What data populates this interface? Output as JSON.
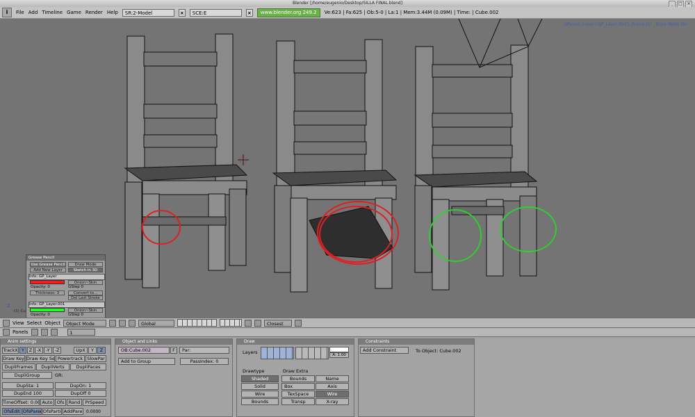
{
  "window": {
    "title": "Blender [/home/eugenio/Desktop/SILLA FINAL.blend]"
  },
  "menubar": {
    "info_icon": "i",
    "items": [
      "File",
      "Add",
      "Timeline",
      "Game",
      "Render",
      "Help"
    ],
    "screen": "SR:2-Model",
    "scene": "SCE:E",
    "url": "www.blender.org 249.2",
    "stats": "Ve:623 | Fa:625 | Ob:5-0 | La:1 | Mem:3.44M (0.09M) | Time: | Cube.002"
  },
  "viewport": {
    "overlay": "GPencil: Layer ('GP_Layer.001'), Frame (1) , Draw Mode On",
    "frame_label": "(1) Cu",
    "axis_label": "z"
  },
  "grease_pencil": {
    "title": "Grease Pencil",
    "use_btn": "Use Grease Pencil",
    "draw_mode": "Draw Mode",
    "add_layer": "Add New Layer",
    "sketch": "Sketch in 3D",
    "layer1": {
      "name": "Info: GP_Layer",
      "opacity": "Opacity: 0",
      "onion": "Onion~Skin",
      "gstep": "GStep 0",
      "thickness": "Thickness: 3",
      "convert": "Convert to...",
      "del": "Del Last Stroke",
      "color": "#ff1a1a"
    },
    "layer2": {
      "name": "Info: GP_Layer.001",
      "opacity": "Opacity: 0",
      "onion": "Onion~Skin",
      "gstep": "GStep 0",
      "color": "#22ff22"
    }
  },
  "view_header": {
    "items": [
      "View",
      "Select",
      "Object"
    ],
    "mode": "Object Mode",
    "orientation": "Global",
    "snap": "Closest"
  },
  "buttons_header": {
    "panels": "Panels",
    "frame": "1"
  },
  "anim_settings": {
    "title": "Anim settings",
    "track": [
      "TrackX",
      "Y",
      "Z",
      "-X",
      "-Y",
      "-Z"
    ],
    "up": [
      "UpX",
      "Y",
      "Z"
    ],
    "row2": [
      "Draw Key",
      "Draw Key Sel",
      "Powertrack",
      "SlowPar"
    ],
    "row3": [
      "DupliFrames",
      "DupliVerts",
      "DupliFaces"
    ],
    "dupligroup": "DupliGroup",
    "gr": "GR:",
    "dupsta": "DupSta: 1",
    "dupon": "DupOn: 1",
    "dupend": "DupEnd 100",
    "dupoff": "DupOff 0",
    "timeoffset": "TimeOffset: 0.00",
    "auto": "Auto",
    "ofs": "Ofs",
    "rand": "Rand",
    "prspeed": "PrSpeed",
    "ofsedit": "OfsEdit",
    "ofsparent": "OfsParen",
    "ofsparticle": "OfsPartic",
    "addparent": "AddPare",
    "value": "0.0000"
  },
  "object_links": {
    "title": "Object and Links",
    "ob": "OB:Cube.002",
    "f": "F",
    "par": "Par:",
    "add_group": "Add to Group",
    "pass_index": "PassIndex: 0"
  },
  "draw": {
    "title": "Draw",
    "layers_label": "Layers",
    "alpha": "A: 1.00",
    "drawtype_label": "Drawtype",
    "drawtypes": [
      "Shaded",
      "Solid",
      "Wire",
      "Bounds"
    ],
    "drawextra_label": "Draw Extra",
    "extra": [
      "Bounds",
      "Name",
      "Box",
      "Axis",
      "TexSpace",
      "Wire",
      "Transp",
      "X-ray"
    ]
  },
  "constraints": {
    "title": "Constraints",
    "add": "Add Constraint",
    "to_object": "To Object: Cube.002"
  }
}
